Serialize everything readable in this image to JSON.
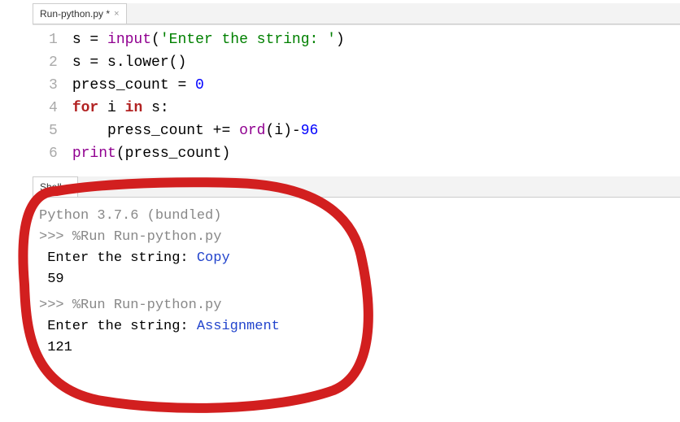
{
  "editor": {
    "tab_title": "Run-python.py *",
    "lines": [
      {
        "n": "1",
        "tokens": [
          "s",
          " = ",
          "input",
          "(",
          "'Enter the string: '",
          ")"
        ]
      },
      {
        "n": "2",
        "tokens": [
          "s",
          " = ",
          "s",
          ".",
          "lower",
          "()"
        ]
      },
      {
        "n": "3",
        "tokens": [
          "press_count",
          " = ",
          "0"
        ]
      },
      {
        "n": "4",
        "tokens": [
          "for ",
          "i",
          " in ",
          "s:"
        ]
      },
      {
        "n": "5",
        "tokens": [
          "    ",
          "press_count",
          " += ",
          "ord",
          "(i)-",
          "96"
        ]
      },
      {
        "n": "6",
        "tokens": [
          "print",
          "(press_count)"
        ]
      }
    ]
  },
  "shell": {
    "tab_title": "Shell",
    "version": "Python 3.7.6 (bundled)",
    "runs": [
      {
        "cmd_prefix": ">>> ",
        "cmd": "%Run Run-python.py",
        "prompt_text": "Enter the string: ",
        "user_input": "Copy",
        "result": "59"
      },
      {
        "cmd_prefix": ">>> ",
        "cmd": "%Run Run-python.py",
        "prompt_text": "Enter the string: ",
        "user_input": "Assignment",
        "result": "121"
      }
    ]
  }
}
